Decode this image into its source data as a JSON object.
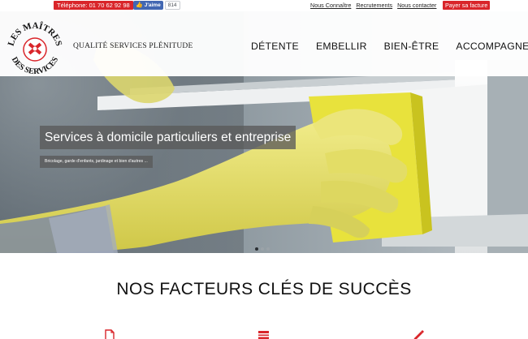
{
  "topbar": {
    "phone_label": "Téléphone: 01 70 62 92 98",
    "fb_like_label": "J'aime",
    "fb_like_count": "814",
    "links": [
      "Nous Connaître",
      "Recrutements",
      "Nous contacter"
    ],
    "pay_label": "Payer sa facture"
  },
  "header": {
    "logo_text_top": "LES MAÎTRES",
    "logo_text_bottom": "DES SERVICES",
    "tagline": "QUALITÉ SERVICES PLÉNITUDE",
    "nav": [
      "DÉTENTE",
      "EMBELLIR",
      "BIEN-ÊTRE",
      "ACCOMPAGNER"
    ]
  },
  "hero": {
    "title": "Services à domicile particuliers et entreprise",
    "subtitle": "Bricolage, garde d'enfants, jardinage et bien d'autres ...",
    "slide_count": 3,
    "active_slide": 1
  },
  "section": {
    "title": "NOS FACTEURS CLÉS DE SUCCÈS"
  },
  "icons": {
    "feature_1": "document-icon",
    "feature_2": "card-icon",
    "feature_3": "pencil-icon"
  },
  "colors": {
    "accent": "#d9252a",
    "facebook": "#4267b2",
    "glove": "#e4df5a",
    "sponge": "#e8e23c"
  }
}
